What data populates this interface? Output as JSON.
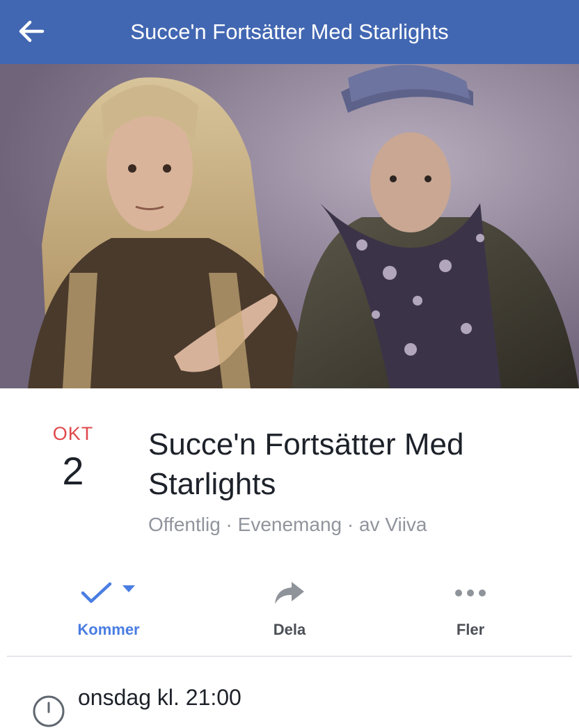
{
  "navbar": {
    "title": "Succe'n Fortsätter Med Starlights",
    "back_icon": "arrow-left-icon",
    "background": "#4267b2"
  },
  "event": {
    "date_month": "OKT",
    "date_day": "2",
    "title": "Succe'n Fortsätter Med Starlights",
    "meta": "Offentlig · Evenemang · av Viiva"
  },
  "actions": [
    {
      "label": "Kommer",
      "icon": "checkmark-icon",
      "active": true,
      "color": "#4a7de2"
    },
    {
      "label": "Dela",
      "icon": "share-arrow-icon",
      "active": false
    },
    {
      "label": "Fler",
      "icon": "more-dots-icon",
      "active": false
    }
  ],
  "details": {
    "time": "onsdag kl. 21:00",
    "time_icon": "clock-icon"
  },
  "colors": {
    "accent_red": "#e0484b",
    "accent_blue": "#4a7de2",
    "muted_text": "#90949c"
  }
}
